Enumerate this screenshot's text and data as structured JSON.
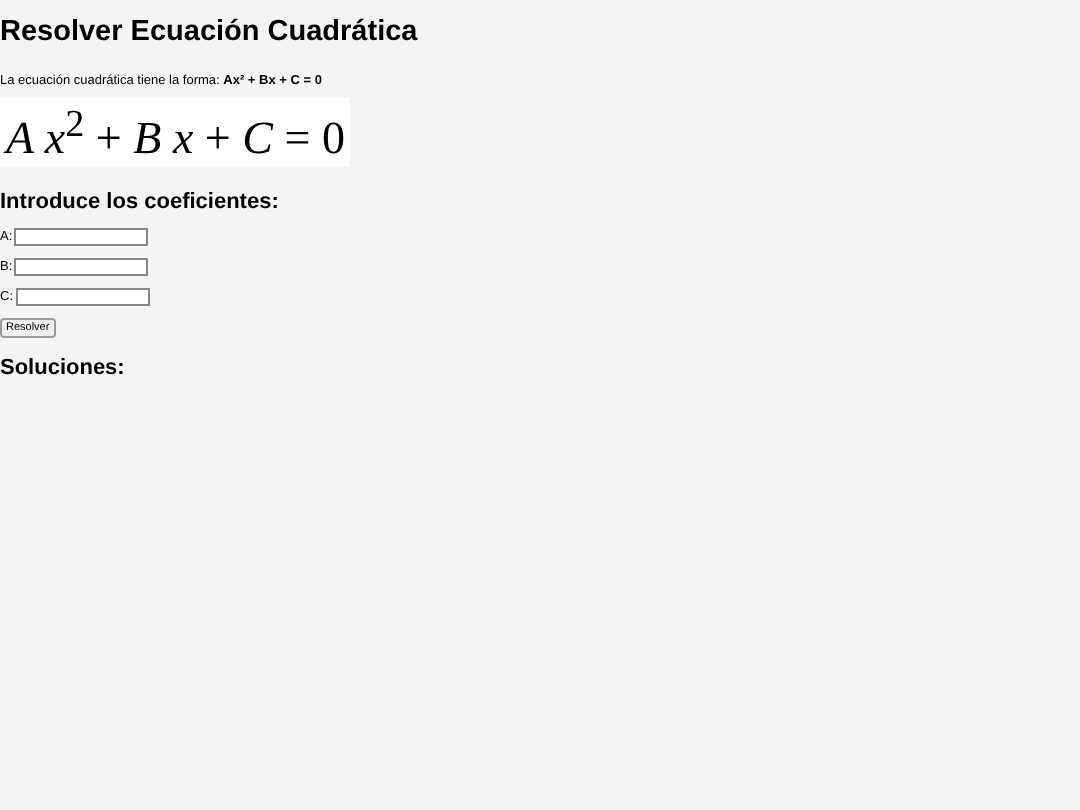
{
  "title": "Resolver Ecuación Cuadrática",
  "intro": {
    "text": "La ecuación cuadrática tiene la forma: ",
    "formula": "Ax² + Bx + C = 0"
  },
  "equation": "*A x*$^{2}$ + *B x* + *C* = 0",
  "coefficients_heading": "Introduce los coeficientes:",
  "fields": [
    {
      "label": "A:"
    },
    {
      "label": "B:"
    },
    {
      "label": "C:"
    }
  ],
  "button": "Resolver",
  "solutions_heading": "Soluciones:"
}
